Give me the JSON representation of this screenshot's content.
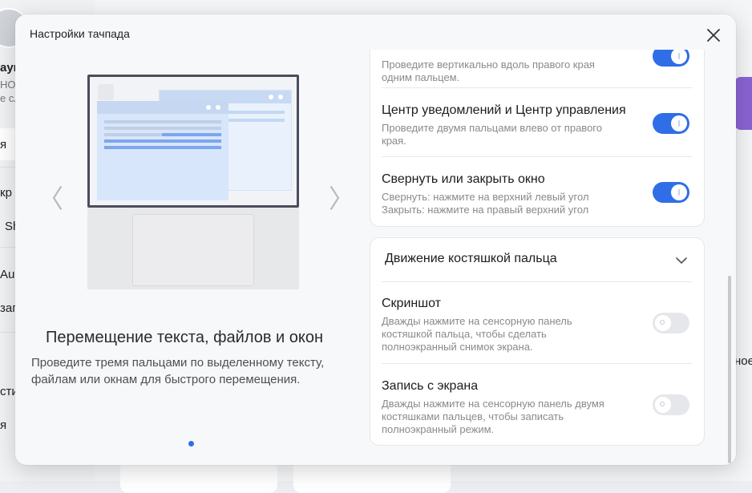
{
  "background": {
    "sidebar_fragments": [
      "аук",
      "HON",
      "е сл",
      "я",
      "кр",
      "Sh",
      "Aud",
      "зап",
      "сти",
      "я"
    ],
    "right_fragment": "ное"
  },
  "dialog": {
    "title": "Настройки тачпада",
    "close_icon": "close-icon"
  },
  "illustration": {
    "prev_arrow": "〈",
    "next_arrow": "〉",
    "gesture_title": "Перемещение текста, файлов и окон",
    "gesture_desc": "Проведите тремя пальцами по выделенному тексту, файлам или окнам для быстрого перемещения.",
    "pages": 1,
    "active_page": 1
  },
  "settings": {
    "top_card": [
      {
        "title": "",
        "desc": "Проведите вертикально вдоль правого края одним пальцем.",
        "enabled": true
      },
      {
        "title": "Центр уведомлений и Центр управления",
        "desc": "Проведите двумя пальцами влево от правого края.",
        "enabled": true
      },
      {
        "title": "Свернуть или закрыть окно",
        "desc_line1": "Свернуть: нажмите на верхний левый угол",
        "desc_line2": "Закрыть: нажмите на правый верхний угол",
        "enabled": true
      }
    ],
    "knuckle_section": {
      "header": "Движение костяшкой пальца",
      "chevron_icon": "chevron-down-icon",
      "items": [
        {
          "title": "Скриншот",
          "desc": "Дважды нажмите на сенсорную панель костяшкой пальца, чтобы сделать полноэкранный снимок экрана.",
          "enabled": false
        },
        {
          "title": "Запись с экрана",
          "desc": "Дважды нажмите на сенсорную панель двумя костяшками пальцев, чтобы записать полноэкранный режим.",
          "enabled": false
        }
      ]
    }
  },
  "colors": {
    "accent": "#2f6ee7",
    "toggle_off": "#e6e7ea",
    "dialog_bg": "#f7f8fa"
  }
}
